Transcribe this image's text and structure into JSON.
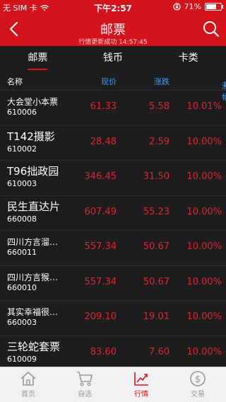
{
  "status_bar": {
    "carrier": "无 SIM 卡",
    "time": "下午2:57",
    "battery": "71%",
    "battery_level": 0.71
  },
  "nav": {
    "title": "邮票",
    "subtitle": "行情更新成功 14:57:45"
  },
  "tabs": [
    {
      "label": "邮票"
    },
    {
      "label": "钱币"
    },
    {
      "label": "卡类"
    }
  ],
  "header": {
    "name": "名称",
    "price": "现价",
    "change": "涨跌",
    "pct": "涨幅",
    "sort_arrow": "↓"
  },
  "rows": [
    {
      "name": "大会堂小本票",
      "code": "610006",
      "price": "61.33",
      "change": "5.58",
      "pct": "10.01%"
    },
    {
      "name": "T142摄影",
      "code": "610002",
      "price": "28.48",
      "change": "2.59",
      "pct": "10.00%"
    },
    {
      "name": "T96拙政园",
      "code": "610003",
      "price": "346.45",
      "change": "31.50",
      "pct": "10.00%"
    },
    {
      "name": "民生直达片",
      "code": "660008",
      "price": "607.49",
      "change": "55.23",
      "pct": "10.00%"
    },
    {
      "name": "四川方言溜…",
      "code": "660011",
      "price": "557.34",
      "change": "50.67",
      "pct": "10.00%"
    },
    {
      "name": "四川方言猴…",
      "code": "660010",
      "price": "557.34",
      "change": "50.67",
      "pct": "10.00%"
    },
    {
      "name": "其实幸福很…",
      "code": "660003",
      "price": "209.10",
      "change": "19.01",
      "pct": "10.00%"
    },
    {
      "name": "三轮蛇套票",
      "code": "610009",
      "price": "83.60",
      "change": "7.60",
      "pct": "10.00%"
    }
  ],
  "tabbar": [
    {
      "label": "首页",
      "icon": "home-icon"
    },
    {
      "label": "自选",
      "icon": "cart-icon"
    },
    {
      "label": "行情",
      "icon": "trend-icon"
    },
    {
      "label": "交易",
      "icon": "dollar-icon"
    }
  ],
  "colors": {
    "brand": "#d4121b",
    "up": "#e0242c",
    "header_accent": "#4a98e6",
    "background": "#1c1c1f"
  }
}
